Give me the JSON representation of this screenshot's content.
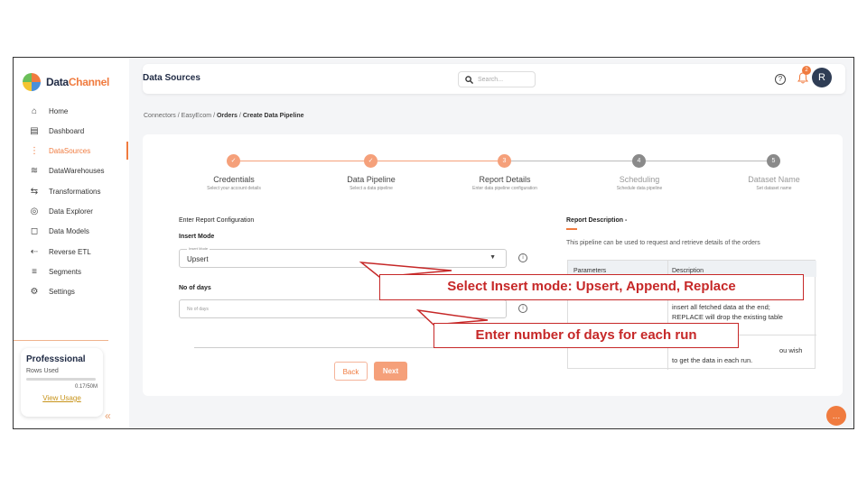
{
  "app": {
    "name_part1": "Data",
    "name_part2": "Channel"
  },
  "header": {
    "title": "Data Sources",
    "search_placeholder": "Search...",
    "help_icon": "?",
    "notification_count": "2",
    "avatar_initial": "R"
  },
  "sidebar": {
    "items": [
      {
        "label": "Home",
        "icon": "⌂"
      },
      {
        "label": "Dashboard",
        "icon": "▤"
      },
      {
        "label": "DataSources",
        "icon": "⋮"
      },
      {
        "label": "DataWarehouses",
        "icon": "≋"
      },
      {
        "label": "Transformations",
        "icon": "⇆"
      },
      {
        "label": "Data Explorer",
        "icon": "◎"
      },
      {
        "label": "Data Models",
        "icon": "◻"
      },
      {
        "label": "Reverse ETL",
        "icon": "⇠"
      },
      {
        "label": "Segments",
        "icon": "≡"
      },
      {
        "label": "Settings",
        "icon": "⚙"
      }
    ],
    "active": "DataSources",
    "plan": {
      "title": "Professsional",
      "rows_label": "Rows Used",
      "rows_value": "0.17/50M",
      "link": "View Usage"
    },
    "collapse_icon": "«"
  },
  "breadcrumb": {
    "items": [
      "Connectors",
      "EasyEcom",
      "Orders",
      "Create Data Pipeline"
    ],
    "separator": "/"
  },
  "stepper": {
    "steps": [
      {
        "label": "Credentials",
        "sub": "Select your account details",
        "state": "done",
        "num": "✓"
      },
      {
        "label": "Data Pipeline",
        "sub": "Select a data pipeline",
        "state": "done",
        "num": "✓"
      },
      {
        "label": "Report Details",
        "sub": "Enter data pipeline configuration",
        "state": "current",
        "num": "3"
      },
      {
        "label": "Scheduling",
        "sub": "Schedule data pipeline",
        "state": "pending",
        "num": "4"
      },
      {
        "label": "Dataset Name",
        "sub": "Set dataset name",
        "state": "pending",
        "num": "5"
      }
    ]
  },
  "form": {
    "section_title": "Enter Report Configuration",
    "insert_mode_label": "Insert Mode",
    "insert_mode_float": "Insert Mode",
    "insert_mode_value": "Upsert",
    "days_label": "No of days",
    "days_placeholder": "No of days",
    "back_label": "Back",
    "next_label": "Next"
  },
  "description": {
    "title": "Report Description -",
    "text": "This pipeline can be used to request and retrieve details of the orders",
    "col1": "Parameters",
    "col2": "Description",
    "row1_line1": "insert all fetched data at the end;",
    "row1_line2": "REPLACE will drop the existing table",
    "row2_line1": "ou wish",
    "row2_line2": "to get the data in each run."
  },
  "callouts": {
    "insert": "Select Insert mode: Upsert, Append, Replace",
    "days": "Enter number of days for each run"
  },
  "chat_icon": "…",
  "colors": {
    "accent": "#f07b3f",
    "callout": "#c62828"
  }
}
